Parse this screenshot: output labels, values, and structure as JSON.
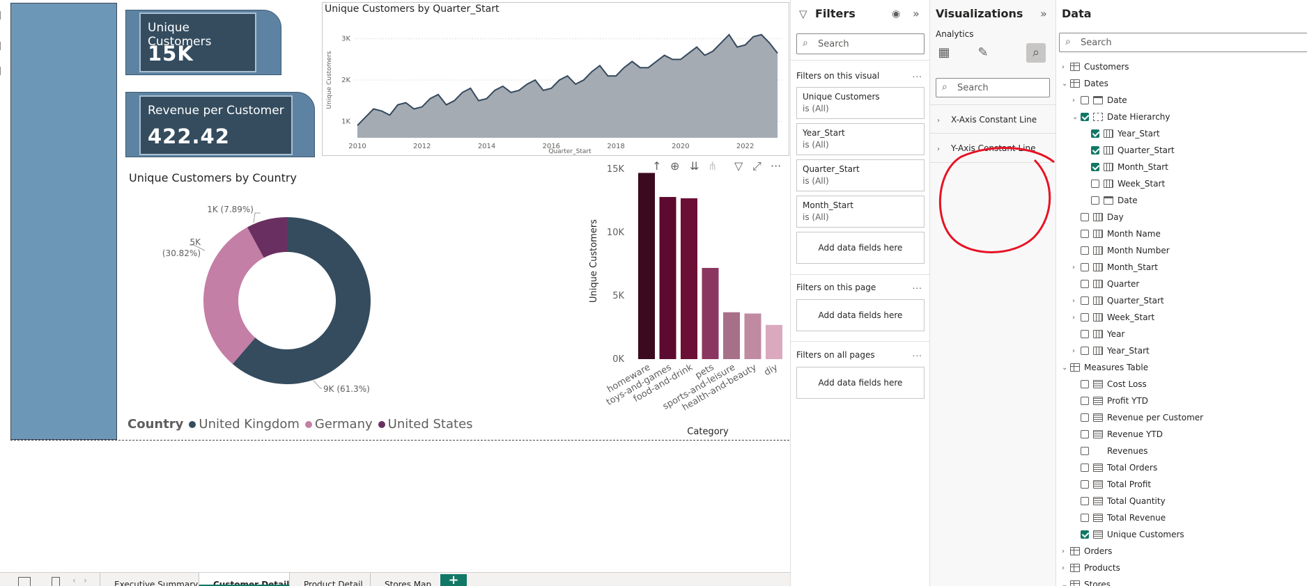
{
  "canvas": {
    "kpi_unique": {
      "label": "Unique Customers",
      "value": "15K"
    },
    "kpi_revenue": {
      "label": "Revenue per Customer",
      "value": "422.42"
    },
    "line_chart": {
      "title": "Unique Customers by Quarter_Start",
      "xlabel": "Quarter_Start",
      "ylabel": "Unique Customers",
      "x_ticks": [
        "2010",
        "2012",
        "2014",
        "2016",
        "2018",
        "2020",
        "2022"
      ],
      "y_ticks": [
        "1K",
        "2K",
        "3K"
      ]
    },
    "donut_chart": {
      "title": "Unique Customers by Country",
      "slice_labels": [
        "9K (61.3%)",
        "5K",
        "(30.82%)",
        "1K (7.89%)"
      ],
      "legend_title": "Country",
      "legend": [
        {
          "label": "United Kingdom",
          "color": "#344c5e"
        },
        {
          "label": "Germany",
          "color": "#c47fa6"
        },
        {
          "label": "United States",
          "color": "#6a2f61"
        }
      ]
    },
    "bar_chart": {
      "xlabel": "Category",
      "ylabel": "Unique Customers",
      "y_ticks": [
        "0K",
        "5K",
        "10K",
        "15K"
      ]
    }
  },
  "chart_data": [
    {
      "type": "area",
      "title": "Unique Customers by Quarter_Start",
      "xlabel": "Quarter_Start",
      "ylabel": "Unique Customers",
      "x": [
        "2010-01",
        "2010-04",
        "2010-07",
        "2010-10",
        "2011-01",
        "2011-04",
        "2011-07",
        "2011-10",
        "2012-01",
        "2012-04",
        "2012-07",
        "2012-10",
        "2013-01",
        "2013-04",
        "2013-07",
        "2013-10",
        "2014-01",
        "2014-04",
        "2014-07",
        "2014-10",
        "2015-01",
        "2015-04",
        "2015-07",
        "2015-10",
        "2016-01",
        "2016-04",
        "2016-07",
        "2016-10",
        "2017-01",
        "2017-04",
        "2017-07",
        "2017-10",
        "2018-01",
        "2018-04",
        "2018-07",
        "2018-10",
        "2019-01",
        "2019-04",
        "2019-07",
        "2019-10",
        "2020-01",
        "2020-04",
        "2020-07",
        "2020-10",
        "2021-01",
        "2021-04",
        "2021-07",
        "2021-10",
        "2022-01",
        "2022-04",
        "2022-07",
        "2022-10",
        "2023-01"
      ],
      "values": [
        900,
        1100,
        1300,
        1250,
        1150,
        1400,
        1450,
        1300,
        1350,
        1550,
        1650,
        1400,
        1500,
        1700,
        1800,
        1500,
        1550,
        1750,
        1850,
        1700,
        1750,
        1900,
        2000,
        1750,
        1800,
        2000,
        2100,
        1900,
        2000,
        2200,
        2350,
        2100,
        2100,
        2300,
        2450,
        2300,
        2300,
        2450,
        2600,
        2500,
        2500,
        2650,
        2800,
        2600,
        2700,
        2900,
        3100,
        2800,
        2850,
        3050,
        3100,
        2900,
        2650
      ],
      "ylim": [
        600,
        3400
      ],
      "color": "#34495e",
      "fill": "#a5abb2"
    },
    {
      "type": "pie",
      "title": "Unique Customers by Country",
      "categories": [
        "United Kingdom",
        "Germany",
        "United States"
      ],
      "values": [
        9,
        5,
        1
      ],
      "percents": [
        61.3,
        30.82,
        7.89
      ],
      "colors": [
        "#344c5e",
        "#c47fa6",
        "#6a2f61"
      ],
      "donut": true
    },
    {
      "type": "bar",
      "xlabel": "Category",
      "ylabel": "Unique Customers",
      "categories": [
        "homeware",
        "toys-and-games",
        "food-and-drink",
        "pets",
        "sports-and-leisure",
        "health-and-beauty",
        "diy"
      ],
      "values": [
        14700,
        12800,
        12700,
        7200,
        3700,
        3600,
        2700
      ],
      "colors": [
        "#3b0a1f",
        "#5c0a2f",
        "#6b0f37",
        "#8a3660",
        "#a87088",
        "#c08aa3",
        "#dba9bd"
      ],
      "ylim": [
        0,
        15000
      ]
    }
  ],
  "tabs": {
    "items": [
      "Executive Summary",
      "Customer Detail",
      "Product Detail",
      "Stores Map"
    ],
    "add": "+"
  },
  "filters": {
    "title": "Filters",
    "search_placeholder": "Search",
    "on_visual_label": "Filters on this visual",
    "more": "...",
    "cards": [
      {
        "name": "Unique Customers",
        "value": "is (All)"
      },
      {
        "name": "Year_Start",
        "value": "is (All)"
      },
      {
        "name": "Quarter_Start",
        "value": "is (All)"
      },
      {
        "name": "Month_Start",
        "value": "is (All)"
      }
    ],
    "add_fields": "Add data fields here",
    "on_page_label": "Filters on this page",
    "all_pages_label": "Filters on all pages"
  },
  "viz": {
    "title": "Visualizations",
    "analytics_label": "Analytics",
    "search_placeholder": "Search",
    "x_const": "X-Axis Constant Line",
    "y_const": "Y-Axis Constant Line"
  },
  "data_pane": {
    "title": "Data",
    "search_placeholder": "Search",
    "fields": [
      {
        "label": "Customers",
        "chev": "›",
        "check": "none",
        "icon": "table",
        "indent": 0
      },
      {
        "label": "Dates",
        "chev": "⌄",
        "check": "none",
        "icon": "table",
        "indent": 0
      },
      {
        "label": "Date",
        "chev": "›",
        "check": "off",
        "icon": "calendar",
        "indent": 1
      },
      {
        "label": "Date Hierarchy",
        "chev": "⌄",
        "check": "on",
        "icon": "hier",
        "indent": 1
      },
      {
        "label": "Year_Start",
        "chev": "",
        "check": "on",
        "icon": "calc",
        "indent": 2
      },
      {
        "label": "Quarter_Start",
        "chev": "",
        "check": "on",
        "icon": "calc",
        "indent": 2
      },
      {
        "label": "Month_Start",
        "chev": "",
        "check": "on",
        "icon": "calc",
        "indent": 2
      },
      {
        "label": "Week_Start",
        "chev": "",
        "check": "off",
        "icon": "calc",
        "indent": 2
      },
      {
        "label": "Date",
        "chev": "",
        "check": "off",
        "icon": "calendar",
        "indent": 2
      },
      {
        "label": "Day",
        "chev": "",
        "check": "off",
        "icon": "calc",
        "indent": 1
      },
      {
        "label": "Month Name",
        "chev": "",
        "check": "off",
        "icon": "calc",
        "indent": 1
      },
      {
        "label": "Month Number",
        "chev": "",
        "check": "off",
        "icon": "calc",
        "indent": 1
      },
      {
        "label": "Month_Start",
        "chev": "›",
        "check": "off",
        "icon": "calc",
        "indent": 1
      },
      {
        "label": "Quarter",
        "chev": "",
        "check": "off",
        "icon": "calc",
        "indent": 1
      },
      {
        "label": "Quarter_Start",
        "chev": "›",
        "check": "off",
        "icon": "calc",
        "indent": 1
      },
      {
        "label": "Week_Start",
        "chev": "›",
        "check": "off",
        "icon": "calc",
        "indent": 1
      },
      {
        "label": "Year",
        "chev": "",
        "check": "off",
        "icon": "calc",
        "indent": 1
      },
      {
        "label": "Year_Start",
        "chev": "›",
        "check": "off",
        "icon": "calc",
        "indent": 1
      },
      {
        "label": "Measures Table",
        "chev": "⌄",
        "check": "none",
        "icon": "table",
        "indent": 0
      },
      {
        "label": "Cost Loss",
        "chev": "",
        "check": "off",
        "icon": "measure",
        "indent": 1
      },
      {
        "label": "Profit YTD",
        "chev": "",
        "check": "off",
        "icon": "measure",
        "indent": 1
      },
      {
        "label": "Revenue per Customer",
        "chev": "",
        "check": "off",
        "icon": "measure",
        "indent": 1
      },
      {
        "label": "Revenue YTD",
        "chev": "",
        "check": "off",
        "icon": "measure",
        "indent": 1
      },
      {
        "label": "Revenues",
        "chev": "",
        "check": "off",
        "icon": "none",
        "indent": 1
      },
      {
        "label": "Total Orders",
        "chev": "",
        "check": "off",
        "icon": "measure",
        "indent": 1
      },
      {
        "label": "Total Profit",
        "chev": "",
        "check": "off",
        "icon": "measure",
        "indent": 1
      },
      {
        "label": "Total Quantity",
        "chev": "",
        "check": "off",
        "icon": "measure",
        "indent": 1
      },
      {
        "label": "Total Revenue",
        "chev": "",
        "check": "off",
        "icon": "measure",
        "indent": 1
      },
      {
        "label": "Unique Customers",
        "chev": "",
        "check": "on",
        "icon": "measure",
        "indent": 1
      },
      {
        "label": "Orders",
        "chev": "›",
        "check": "none",
        "icon": "table",
        "indent": 0
      },
      {
        "label": "Products",
        "chev": "›",
        "check": "none",
        "icon": "table",
        "indent": 0
      },
      {
        "label": "Stores",
        "chev": "⌄",
        "check": "none",
        "icon": "table",
        "indent": 0
      }
    ]
  },
  "annotation": {
    "color": "#e81123"
  }
}
